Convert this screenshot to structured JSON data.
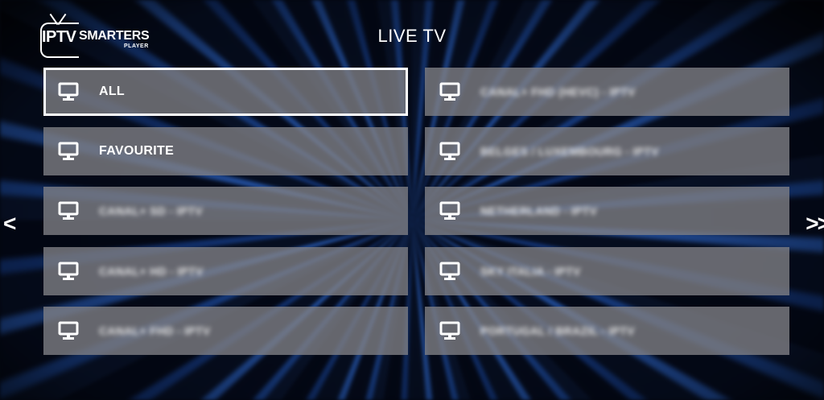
{
  "logo": {
    "iptv": "IPTV",
    "smarters": "SMARTERS",
    "player": "PLAYER"
  },
  "header": {
    "title": "LIVE TV"
  },
  "nav": {
    "prev": "<",
    "next": ">>"
  },
  "categories": {
    "left": [
      {
        "label": "ALL",
        "selected": true,
        "blurred": false
      },
      {
        "label": "FAVOURITE",
        "selected": false,
        "blurred": false
      },
      {
        "label": "CANAL+ SD - IPTV",
        "selected": false,
        "blurred": true
      },
      {
        "label": "CANAL+ HD - IPTV",
        "selected": false,
        "blurred": true
      },
      {
        "label": "CANAL+ FHD - IPTV",
        "selected": false,
        "blurred": true
      }
    ],
    "right": [
      {
        "label": "CANAL+ FHD (HEVC) - IPTV",
        "selected": false,
        "blurred": true
      },
      {
        "label": "BELGES / LUXEMBOURG - IPTV",
        "selected": false,
        "blurred": true
      },
      {
        "label": "NETHERLAND - IPTV",
        "selected": false,
        "blurred": true
      },
      {
        "label": "SKY ITALIA - IPTV",
        "selected": false,
        "blurred": true
      },
      {
        "label": "PORTUGAL / BRAZIL - IPTV",
        "selected": false,
        "blurred": true
      }
    ]
  },
  "icons": {
    "tile_icon": "monitor-icon"
  },
  "colors": {
    "tile_bg": "#828287",
    "selected_border": "#ffffff",
    "accent_blue": "#1e4fa8"
  }
}
